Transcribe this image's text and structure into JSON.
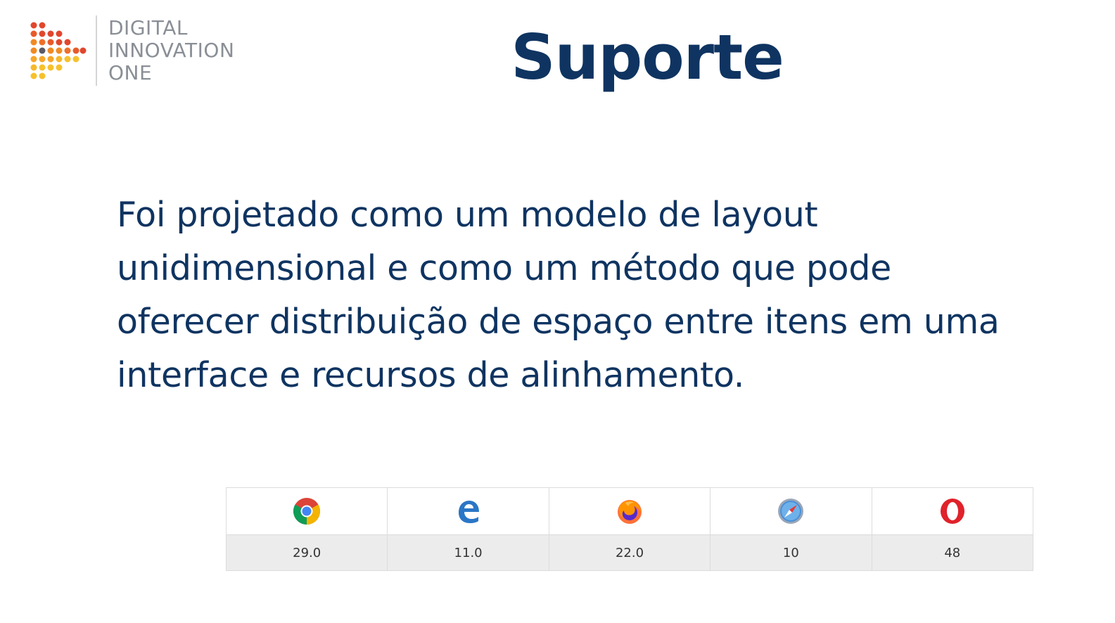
{
  "logo": {
    "lines": [
      "DIGITAL",
      "INNOVATION",
      "ONE"
    ],
    "colors": {
      "red": "#e0472d",
      "orange": "#f08a24",
      "yellow": "#f6c12c",
      "text": "#8a8f96"
    }
  },
  "slide": {
    "title": "Suporte",
    "body_lines": [
      "Foi projetado como um modelo de layout",
      "unidimensional e como um método que pode",
      "oferecer distribuição de espaço entre itens em uma",
      "interface e recursos de alinhamento."
    ],
    "title_color": "#0f3461",
    "text_color": "#0f3461"
  },
  "support_table": {
    "browsers": [
      {
        "icon": "chrome-icon",
        "version": "29.0"
      },
      {
        "icon": "edge-icon",
        "version": "11.0"
      },
      {
        "icon": "firefox-icon",
        "version": "22.0"
      },
      {
        "icon": "safari-icon",
        "version": "10"
      },
      {
        "icon": "opera-icon",
        "version": "48"
      }
    ]
  }
}
